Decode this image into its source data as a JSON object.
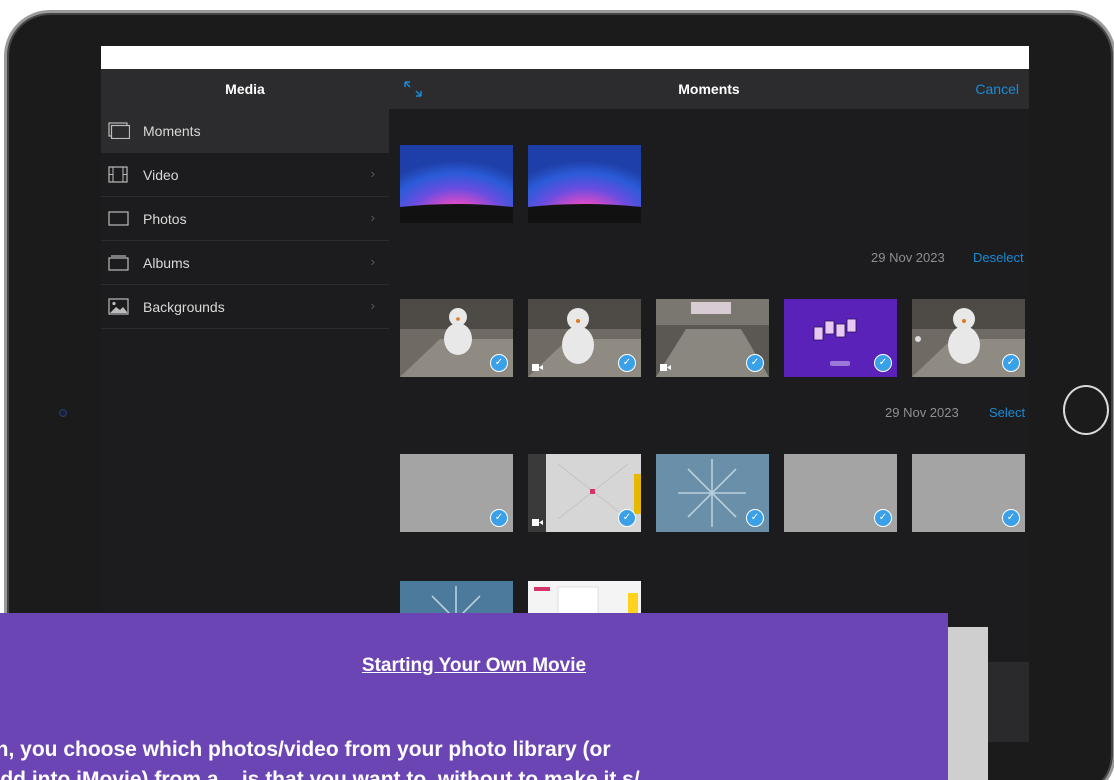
{
  "sidebar": {
    "title": "Media",
    "items": [
      {
        "label": "Moments",
        "icon": "moments-icon",
        "active": true
      },
      {
        "label": "Video",
        "icon": "film-icon"
      },
      {
        "label": "Photos",
        "icon": "photo-frame-icon"
      },
      {
        "label": "Albums",
        "icon": "albums-icon"
      },
      {
        "label": "Backgrounds",
        "icon": "landscape-icon"
      }
    ]
  },
  "main": {
    "title": "Moments",
    "cancel_label": "Cancel",
    "sections": [
      {
        "date": "29 Nov 2023",
        "action": "Deselect"
      },
      {
        "date": "29 Nov 2023",
        "action": "Select"
      }
    ]
  },
  "overlay": {
    "title": "Starting Your Own Movie",
    "line1": "tion, you choose which photos/video from your photo library (or",
    "line2": "o add into iMovie) from a ...is that you want to, without to make it s/"
  },
  "colors": {
    "accent": "#1a8bd4",
    "overlay": "#6c45b5",
    "check": "#3aa0e8"
  }
}
